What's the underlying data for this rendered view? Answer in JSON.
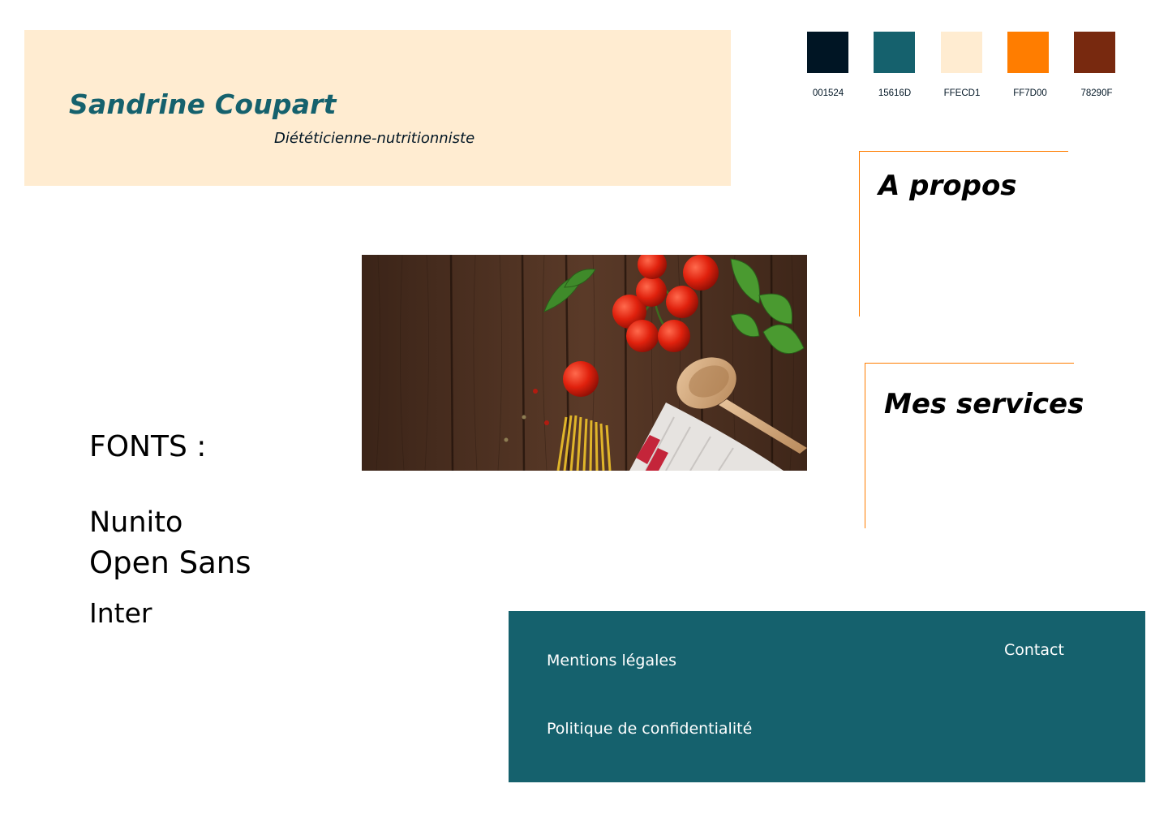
{
  "header": {
    "name": "Sandrine Coupart",
    "tagline": "Diététicienne-nutritionniste"
  },
  "palette": [
    {
      "color": "#001524",
      "code": "001524"
    },
    {
      "color": "#15616D",
      "code": "15616D"
    },
    {
      "color": "#FFECD1",
      "code": "FFECD1"
    },
    {
      "color": "#FF7D00",
      "code": "FF7D00"
    },
    {
      "color": "#78290F",
      "code": "78290F"
    }
  ],
  "sections": {
    "about_title": "A propos",
    "services_title": "Mes services"
  },
  "fonts": {
    "heading": "FONTS :",
    "items": [
      "Nunito",
      "Open Sans",
      "Inter"
    ]
  },
  "hero_image": {
    "icon": "food-ingredients-photo"
  },
  "footer": {
    "legal": "Mentions légales",
    "privacy": "Politique de confidentialité",
    "contact": "Contact"
  },
  "colors": {
    "accent_line": "#FF7D00",
    "banner_bg": "#FFECD1",
    "footer_bg": "#15616D",
    "brand": "#15616D"
  }
}
